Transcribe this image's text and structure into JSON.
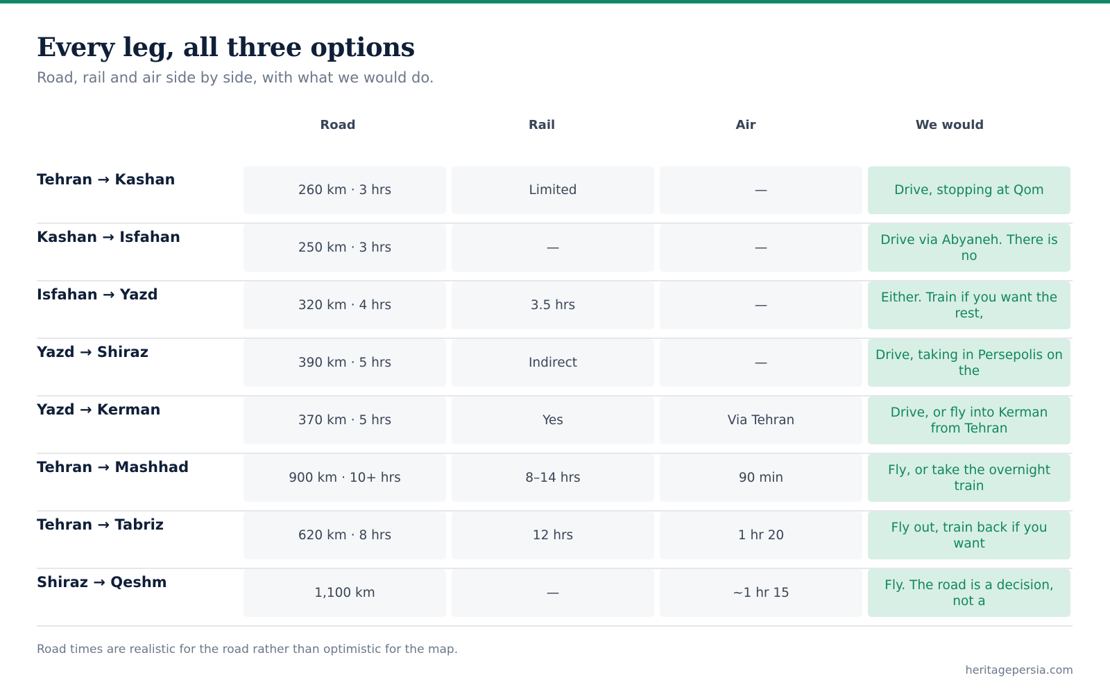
{
  "page": {
    "title": "Every leg, all three options",
    "subtitle": "Road, rail and air side by side, with what we would do.",
    "accent_color": "#13876a"
  },
  "table": {
    "columns": [
      "Road",
      "Rail",
      "Air",
      "We would"
    ],
    "rows": [
      {
        "route": "Tehran → Kashan",
        "road": "260 km · 3 hrs",
        "rail": "Limited",
        "air": "—",
        "recommendation": "Drive, stopping at Qom"
      },
      {
        "route": "Kashan → Isfahan",
        "road": "250 km · 3 hrs",
        "rail": "—",
        "air": "—",
        "recommendation": "Drive via Abyaneh. There is no"
      },
      {
        "route": "Isfahan → Yazd",
        "road": "320 km · 4 hrs",
        "rail": "3.5 hrs",
        "air": "—",
        "recommendation": "Either. Train if you want the rest,"
      },
      {
        "route": "Yazd → Shiraz",
        "road": "390 km · 5 hrs",
        "rail": "Indirect",
        "air": "—",
        "recommendation": "Drive, taking in Persepolis on the"
      },
      {
        "route": "Yazd → Kerman",
        "road": "370 km · 5 hrs",
        "rail": "Yes",
        "air": "Via Tehran",
        "recommendation": "Drive, or fly into Kerman from Tehran"
      },
      {
        "route": "Tehran → Mashhad",
        "road": "900 km · 10+ hrs",
        "rail": "8–14 hrs",
        "air": "90 min",
        "recommendation": "Fly, or take the overnight train"
      },
      {
        "route": "Tehran → Tabriz",
        "road": "620 km · 8 hrs",
        "rail": "12 hrs",
        "air": "1 hr 20",
        "recommendation": "Fly out, train back if you want"
      },
      {
        "route": "Shiraz → Qeshm",
        "road": "1,100 km",
        "rail": "—",
        "air": "~1 hr 15",
        "recommendation": "Fly. The road is a decision, not a"
      }
    ]
  },
  "footer": {
    "note": "Road times are realistic for the road rather than optimistic for the map.",
    "source": "heritagepersia.com"
  }
}
